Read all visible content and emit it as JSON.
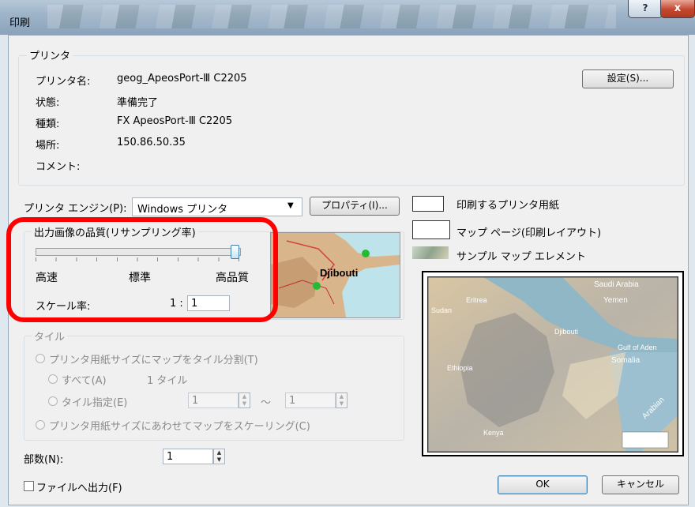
{
  "window": {
    "title": "印刷",
    "help_label": "?",
    "close_label": "x"
  },
  "printer_group": {
    "title": "プリンタ",
    "fields": [
      {
        "label": "プリンタ名:",
        "value": "geog_ApeosPort-Ⅲ C2205"
      },
      {
        "label": "状態:",
        "value": "準備完了"
      },
      {
        "label": "種類:",
        "value": "FX ApeosPort-Ⅲ C2205"
      },
      {
        "label": "場所:",
        "value": "150.86.50.35"
      },
      {
        "label": "コメント:",
        "value": ""
      }
    ],
    "settings_button": "設定(S)..."
  },
  "engine": {
    "label": "プリンタ エンジン(P):",
    "value": "Windows プリンタ",
    "properties_button": "プロパティ(I)..."
  },
  "quality_group": {
    "title": "出力画像の品質(リサンプリング率)",
    "slider_labels": [
      "高速",
      "標準",
      "高品質"
    ],
    "slider_level": 1.0,
    "scale_label": "スケール率:",
    "scale_prefix": "1 :",
    "scale_value": "1"
  },
  "tile_group": {
    "title": "タイル",
    "tile_option": "プリンタ用紙サイズにマップをタイル分割(T)",
    "all_option": "すべて(A)",
    "all_count": "1 タイル",
    "specify_option": "タイル指定(E)",
    "range_from": "1",
    "range_sep": "～",
    "range_to": "1",
    "scale_option": "プリンタ用紙サイズにあわせてマップをスケーリング(C)"
  },
  "legend": [
    {
      "label": "印刷するプリンタ用紙"
    },
    {
      "label": "マップ ページ(印刷レイアウト)"
    },
    {
      "label": "サンプル マップ エレメント"
    }
  ],
  "preview": {
    "thumb_label": "Djibouti",
    "map_labels": {
      "saudi": "Saudi Arabia",
      "yemen": "Yemen",
      "gulf": "Gulf of Aden",
      "eritrea": "Eritrea",
      "sudan": "Sudan",
      "djibouti": "Djibouti",
      "ethiopia": "Ethiopia",
      "somalia": "Somalia",
      "kenya": "Kenya",
      "arabian": "Arabian"
    }
  },
  "copies": {
    "label": "部数(N):",
    "value": "1"
  },
  "print_to_file": {
    "label": "ファイルへ出力(F)",
    "checked": false
  },
  "buttons": {
    "ok": "OK",
    "cancel": "キャンセル"
  }
}
